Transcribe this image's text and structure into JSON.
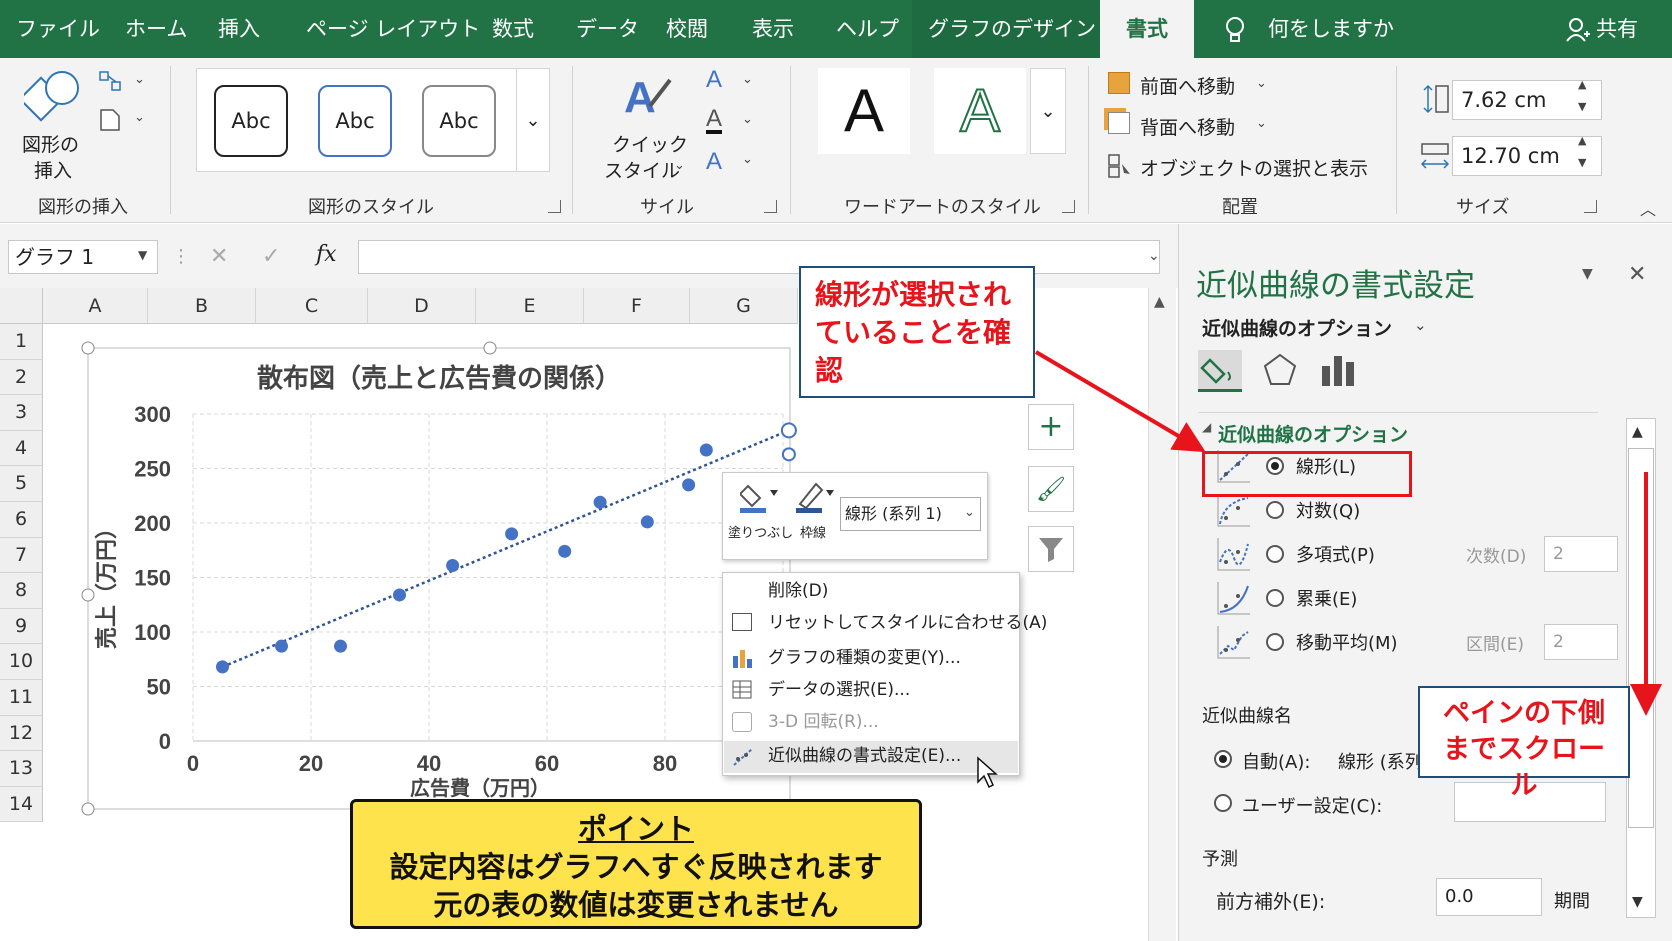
{
  "ribbon_tabs": [
    {
      "label": "ファイル"
    },
    {
      "label": "ホーム"
    },
    {
      "label": "挿入"
    },
    {
      "label": "ページ レイアウト"
    },
    {
      "label": "数式"
    },
    {
      "label": "データ"
    },
    {
      "label": "校閲"
    },
    {
      "label": "表示"
    },
    {
      "label": "ヘルプ"
    },
    {
      "label": "グラフのデザイン"
    },
    {
      "label": "書式"
    }
  ],
  "tell_me": "何をしますか",
  "share": "共有",
  "ribbon": {
    "insert_shapes": {
      "button": "図形の",
      "button2": "挿入",
      "group": "図形の挿入"
    },
    "shape_styles": {
      "samples": [
        "Abc",
        "Abc",
        "Abc"
      ],
      "group": "図形のスタイル"
    },
    "quick_style": {
      "line1": "クイック",
      "line2": "スタイル",
      "group": "サイル"
    },
    "wordart": {
      "samples": [
        "A",
        "A"
      ],
      "group": "ワードアートのスタイル"
    },
    "arrange": {
      "bring_forward": "前面へ移動",
      "send_backward": "背面へ移動",
      "selection_pane": "オブジェクトの選択と表示",
      "group": "配置"
    },
    "size": {
      "height": "7.62 cm",
      "width": "12.70 cm",
      "group": "サイズ"
    }
  },
  "name_box": "グラフ 1",
  "fx": "fx",
  "columns": [
    "A",
    "B",
    "C",
    "D",
    "E",
    "F",
    "G"
  ],
  "rows": [
    "1",
    "2",
    "3",
    "4",
    "5",
    "6",
    "7",
    "8",
    "9",
    "10",
    "11",
    "12",
    "13",
    "14"
  ],
  "chart_data": {
    "type": "scatter",
    "title": "散布図（売上と広告費の関係）",
    "xlabel": "広告費（万円）",
    "ylabel": "売上（万円）",
    "xlim": [
      0,
      100
    ],
    "ylim": [
      0,
      300
    ],
    "xticks": [
      "0",
      "20",
      "40",
      "60",
      "80"
    ],
    "yticks": [
      "0",
      "50",
      "100",
      "150",
      "200",
      "250",
      "300"
    ],
    "grid": true,
    "series": [
      {
        "points": [
          [
            5,
            68
          ],
          [
            15,
            87
          ],
          [
            25,
            87
          ],
          [
            35,
            134
          ],
          [
            44,
            161
          ],
          [
            54,
            190
          ],
          [
            63,
            174
          ],
          [
            69,
            219
          ],
          [
            77,
            201
          ],
          [
            84,
            235
          ],
          [
            87,
            267
          ]
        ],
        "trendline": {
          "type": "linear",
          "x": [
            5,
            101
          ],
          "y": [
            68,
            285
          ]
        }
      }
    ],
    "colors": {
      "marker": "#4472c4",
      "trendline": "#2f5597"
    }
  },
  "mini_toolbar": {
    "fill_label": "塗りつぶし",
    "outline_label": "枠線",
    "dropdown": "線形 (系列 1)"
  },
  "context_menu": [
    {
      "label": "削除(D)",
      "enabled": true
    },
    {
      "label": "リセットしてスタイルに合わせる(A)",
      "enabled": true
    },
    {
      "label": "グラフの種類の変更(Y)...",
      "enabled": true
    },
    {
      "label": "データの選択(E)...",
      "enabled": true
    },
    {
      "label": "3-D 回転(R)...",
      "enabled": false
    },
    {
      "label": "近似曲線の書式設定(E)...",
      "enabled": true,
      "highlighted": true
    }
  ],
  "callout_linear": "線形が選択されていることを確認",
  "callout_scroll": "ペインの下側までスクロール",
  "point_box": {
    "title": "ポイント",
    "line1": "設定内容はグラフへすぐ反映されます",
    "line2": "元の表の数値は変更されません"
  },
  "pane": {
    "title": "近似曲線の書式設定",
    "subtitle": "近似曲線のオプション",
    "section": "近似曲線のオプション",
    "options": [
      {
        "label": "線形(L)",
        "selected": true
      },
      {
        "label": "対数(Q)",
        "selected": false
      },
      {
        "label": "多項式(P)",
        "selected": false,
        "param_label": "次数(D)",
        "param_value": "2"
      },
      {
        "label": "累乗(E)",
        "selected": false
      },
      {
        "label": "移動平均(M)",
        "selected": false,
        "param_label": "区間(E)",
        "param_value": "2"
      }
    ],
    "name_section": "近似曲線名",
    "auto_label": "自動(A):",
    "auto_value": "線形 (系列",
    "custom_label": "ユーザー設定(C):",
    "forecast": "予測",
    "forward_label": "前方補外(E):",
    "forward_value": "0.0",
    "period": "期間"
  },
  "colors": {
    "excel_green": "#217346",
    "callout_red": "#e8141b",
    "point_yellow": "#ffe34d",
    "pane_green": "#217346"
  }
}
